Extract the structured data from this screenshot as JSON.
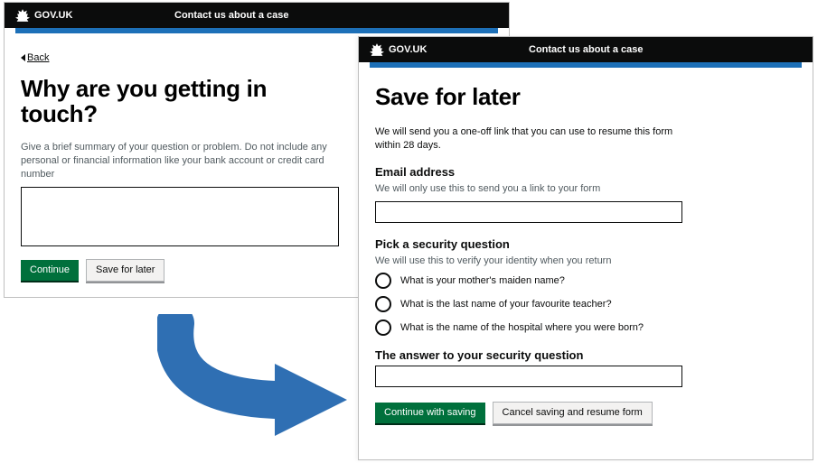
{
  "brand": "GOV.UK",
  "service": "Contact us about a case",
  "left": {
    "back": "Back",
    "heading": "Why are you getting in touch?",
    "hint": "Give a brief summary of your question or problem. Do not include any personal or financial information like your bank account or credit card number",
    "textarea_value": "",
    "continue": "Continue",
    "save": "Save for later"
  },
  "right": {
    "heading": "Save for later",
    "intro": "We will send you a one-off link that you can use to resume this form within 28 days.",
    "email_label": "Email address",
    "email_hint": "We will only use this to send you a link to your form",
    "email_value": "",
    "question_label": "Pick a security question",
    "question_hint": "We will use this to verify your identity when you return",
    "radios": {
      "0": "What is your mother's maiden name?",
      "1": "What is the last name of your favourite teacher?",
      "2": "What is the name of the hospital where you were born?"
    },
    "answer_label": "The answer to your security question",
    "answer_value": "",
    "continue": "Continue with saving",
    "cancel": "Cancel saving and resume form"
  }
}
